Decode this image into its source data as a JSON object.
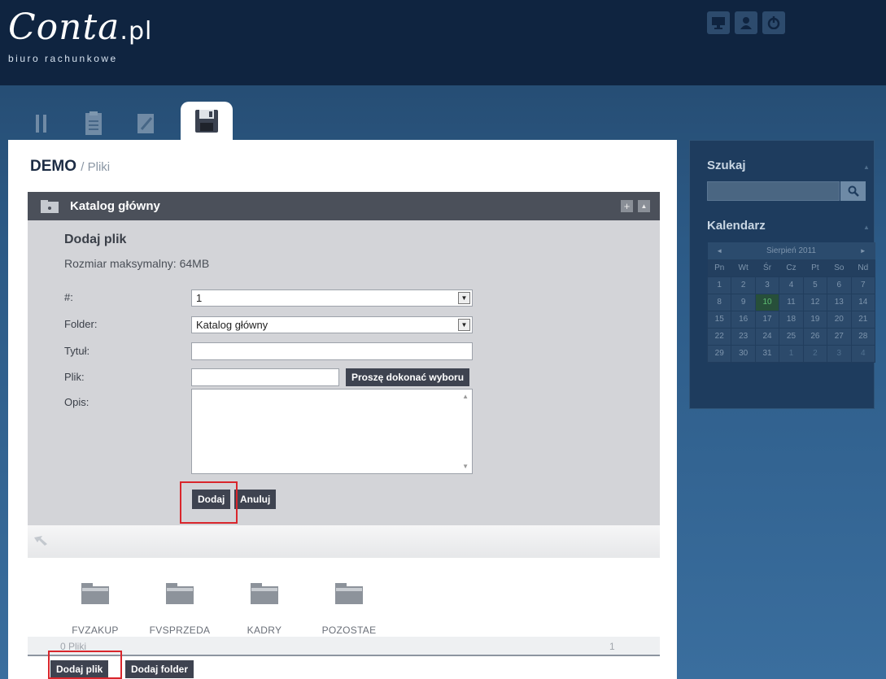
{
  "app": {
    "brand": "Conta",
    "brand_suffix": ".pl",
    "tagline": "biuro rachunkowe"
  },
  "header_icons": [
    "monitor-icon",
    "user-icon",
    "power-icon"
  ],
  "tabs": [
    "tools-icon",
    "clipboard-icon",
    "notepad-icon",
    "floppy-disk-icon"
  ],
  "breadcrumb": {
    "main": "DEMO",
    "sub": "/ Pliki"
  },
  "panel": {
    "title": "Katalog główny",
    "add_ctrl": "+",
    "collapse_ctrl": "▲"
  },
  "form": {
    "title": "Dodaj plik",
    "max_size": "Rozmiar maksymalny: 64MB",
    "number_label": "#:",
    "number_value": "1",
    "folder_label": "Folder:",
    "folder_value": "Katalog główny",
    "title_label": "Tytuł:",
    "file_label": "Plik:",
    "browse_button": "Proszę dokonać wyboru",
    "desc_label": "Opis:",
    "submit_button": "Dodaj",
    "cancel_button": "Anuluj",
    "scroll_up": "▲",
    "scroll_down": "▼",
    "select_arrow": "▼"
  },
  "folders": [
    {
      "name": "FVZAKUP"
    },
    {
      "name": "FVSPRZEDA"
    },
    {
      "name": "KADRY"
    },
    {
      "name": "POZOSTAE"
    }
  ],
  "status": {
    "files_count": "0 Pliki",
    "page": "1"
  },
  "footer_buttons": {
    "add_file": "Dodaj plik",
    "add_folder": "Dodaj folder"
  },
  "sidebar": {
    "search_title": "Szukaj",
    "calendar_title": "Kalendarz",
    "caret": "▲",
    "calendar": {
      "month": "Sierpień 2011",
      "prev": "◄",
      "next": "►",
      "weekdays": [
        "Pn",
        "Wt",
        "Śr",
        "Cz",
        "Pt",
        "So",
        "Nd"
      ],
      "weeks": [
        [
          "1",
          "2",
          "3",
          "4",
          "5",
          "6",
          "7"
        ],
        [
          "8",
          "9",
          "10",
          "11",
          "12",
          "13",
          "14"
        ],
        [
          "15",
          "16",
          "17",
          "18",
          "19",
          "20",
          "21"
        ],
        [
          "22",
          "23",
          "24",
          "25",
          "26",
          "27",
          "28"
        ],
        [
          "29",
          "30",
          "31",
          "1",
          "2",
          "3",
          "4"
        ]
      ],
      "today": "10"
    }
  },
  "colors": {
    "header_bg": "#0f2440",
    "panel_head": "#4b505a",
    "form_bg": "#d3d4d8",
    "button": "#3e4350",
    "highlight_box": "#d9262c",
    "today": "#5fbf74"
  }
}
